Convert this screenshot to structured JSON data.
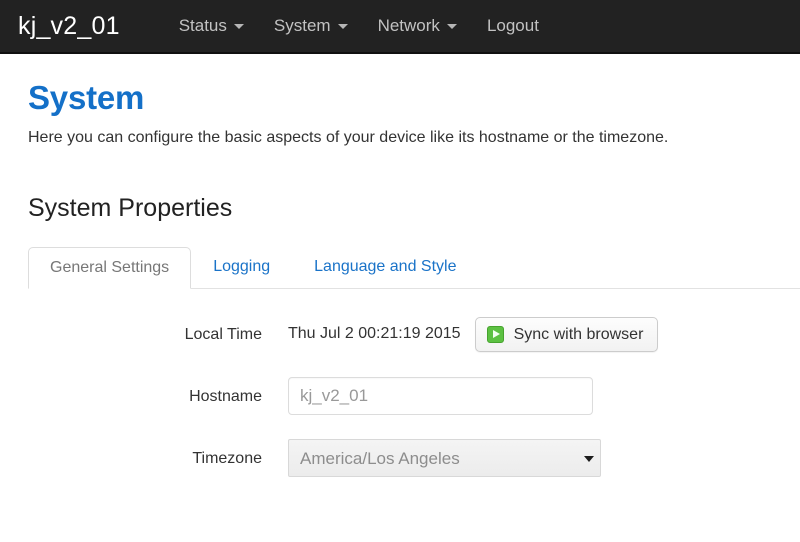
{
  "navbar": {
    "brand": "kj_v2_01",
    "items": [
      {
        "label": "Status",
        "has_caret": true
      },
      {
        "label": "System",
        "has_caret": true
      },
      {
        "label": "Network",
        "has_caret": true
      },
      {
        "label": "Logout",
        "has_caret": false
      }
    ],
    "background_color": "#222222",
    "text_color": "#c2c2c2"
  },
  "page": {
    "title": "System",
    "title_color": "#1470c8",
    "description": "Here you can configure the basic aspects of your device like its hostname or the timezone.",
    "section_title": "System Properties"
  },
  "tabs": [
    {
      "label": "General Settings",
      "active": true
    },
    {
      "label": "Logging",
      "active": false
    },
    {
      "label": "Language and Style",
      "active": false
    }
  ],
  "form": {
    "local_time": {
      "label": "Local Time",
      "value": "Thu Jul 2 00:21:19 2015",
      "sync_button_label": "Sync with browser",
      "sync_button_icon": "play-icon",
      "icon_color": "#5cc142"
    },
    "hostname": {
      "label": "Hostname",
      "value": "kj_v2_01",
      "placeholder": "kj_v2_01"
    },
    "timezone": {
      "label": "Timezone",
      "selected": "America/Los Angeles",
      "options": [
        "America/Los Angeles"
      ]
    }
  }
}
